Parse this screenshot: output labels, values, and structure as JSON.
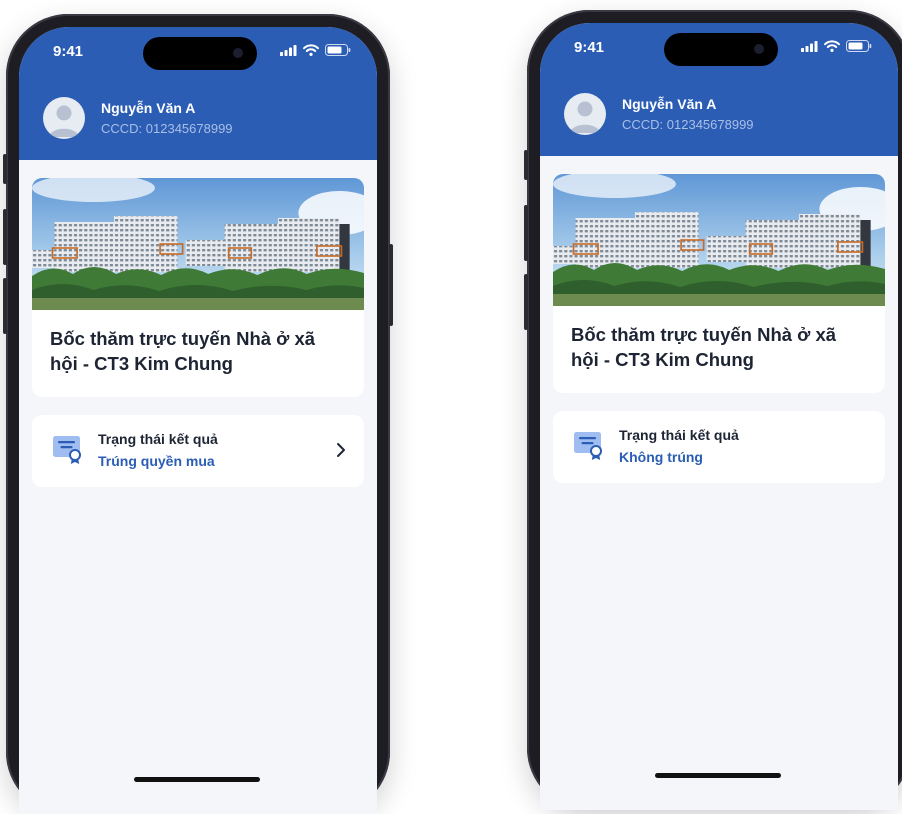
{
  "status_bar": {
    "time": "9:41"
  },
  "user": {
    "name": "Nguyễn Văn A",
    "id_line": "CCCD: 012345678999"
  },
  "project": {
    "title": "Bốc thăm trực tuyến Nhà ở xã hội - CT3 Kim Chung"
  },
  "result": {
    "label": "Trạng thái kết quả"
  },
  "screens": [
    {
      "result_value": "Trúng quyền mua",
      "has_chevron": true
    },
    {
      "result_value": "Không trúng",
      "has_chevron": false
    }
  ],
  "colors": {
    "header_blue": "#2b5db5",
    "screen_background": "#f4f6fa",
    "result_value_blue": "#2b5db5",
    "phone_frame": "#1f1d24"
  },
  "icons": [
    "signal-icon",
    "wifi-icon",
    "battery-icon",
    "avatar-icon",
    "certificate-icon",
    "chevron-right-icon"
  ]
}
